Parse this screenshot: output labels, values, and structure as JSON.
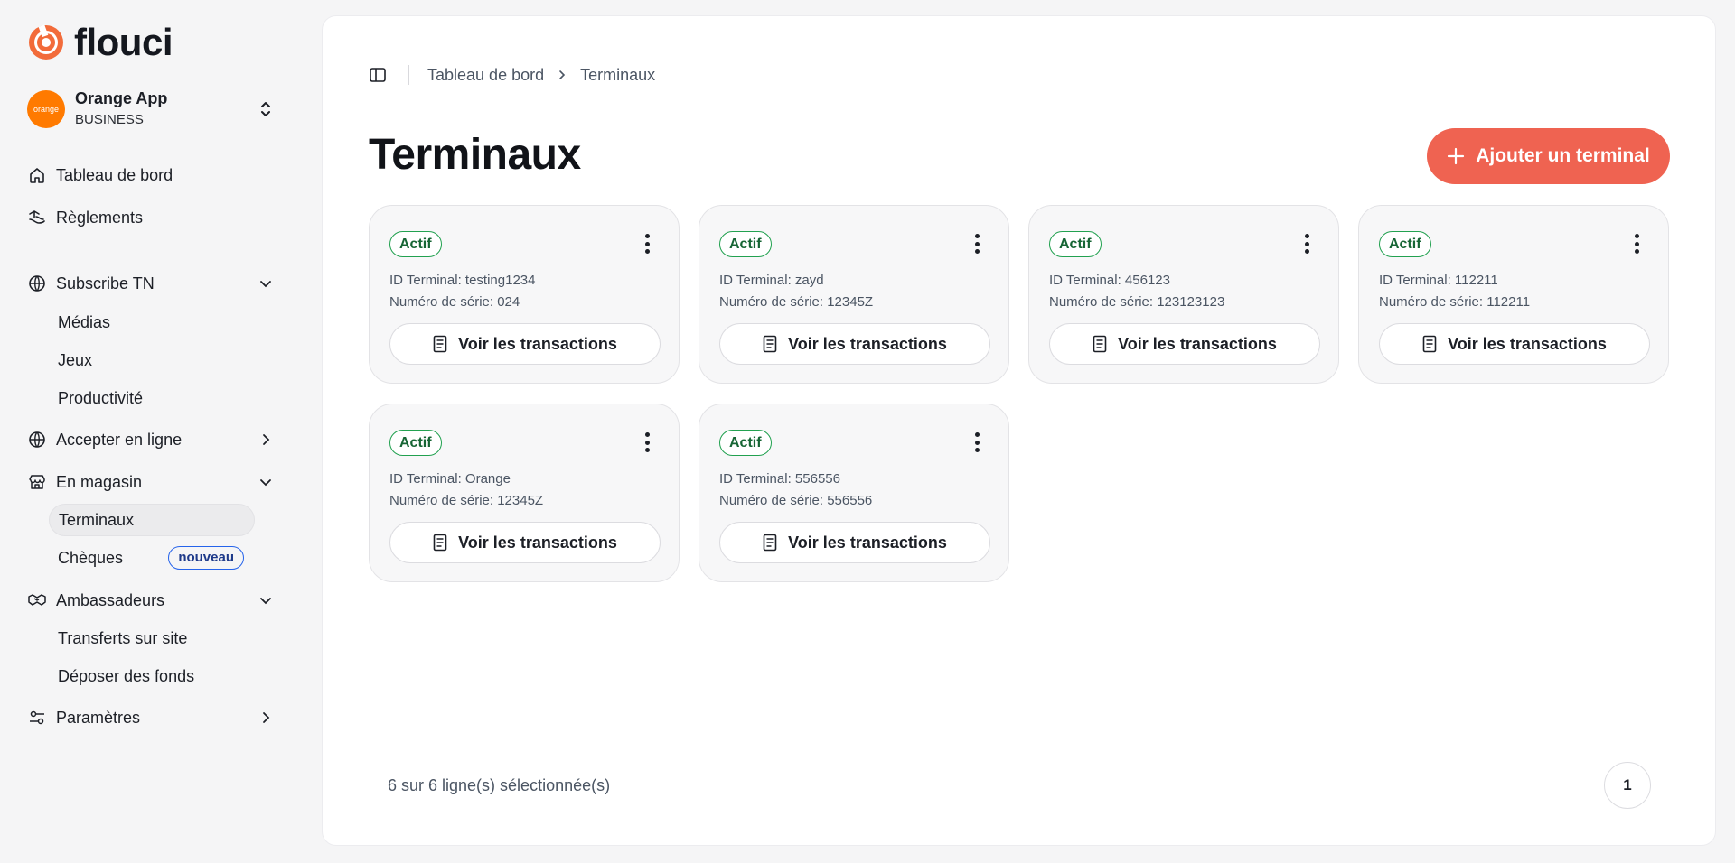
{
  "brand": {
    "name": "flouci",
    "accent": "#ef6351"
  },
  "org": {
    "name": "Orange App",
    "type": "BUSINESS",
    "avatar_text": "orange"
  },
  "nav": {
    "dashboard": "Tableau de bord",
    "payments": "Règlements",
    "subscribe": "Subscribe TN",
    "subscribe_items": [
      "Médias",
      "Jeux",
      "Productivité"
    ],
    "accept_online": "Accepter en ligne",
    "in_store": "En magasin",
    "in_store_items": [
      "Terminaux",
      "Chèques"
    ],
    "new_badge": "nouveau",
    "ambassadors": "Ambassadeurs",
    "ambassador_items": [
      "Transferts sur site",
      "Déposer des fonds"
    ],
    "settings": "Paramètres"
  },
  "breadcrumb": {
    "root": "Tableau de bord",
    "current": "Terminaux"
  },
  "page": {
    "title": "Terminaux",
    "add_button": "Ajouter un terminal"
  },
  "terminals": [
    {
      "status": "Actif",
      "id_line": "ID Terminal: testing1234",
      "serial_line": "Numéro de série: 024",
      "button": "Voir les transactions"
    },
    {
      "status": "Actif",
      "id_line": "ID Terminal: zayd",
      "serial_line": "Numéro de série: 12345Z",
      "button": "Voir les transactions"
    },
    {
      "status": "Actif",
      "id_line": "ID Terminal: 456123",
      "serial_line": "Numéro de série: 123123123",
      "button": "Voir les transactions"
    },
    {
      "status": "Actif",
      "id_line": "ID Terminal: 112211",
      "serial_line": "Numéro de série: 112211",
      "button": "Voir les transactions"
    },
    {
      "status": "Actif",
      "id_line": "ID Terminal: Orange",
      "serial_line": "Numéro de série: 12345Z",
      "button": "Voir les transactions"
    },
    {
      "status": "Actif",
      "id_line": "ID Terminal: 556556",
      "serial_line": "Numéro de série: 556556",
      "button": "Voir les transactions"
    }
  ],
  "footer": {
    "selection": "6 sur 6 ligne(s) sélectionnée(s)",
    "page": "1"
  }
}
